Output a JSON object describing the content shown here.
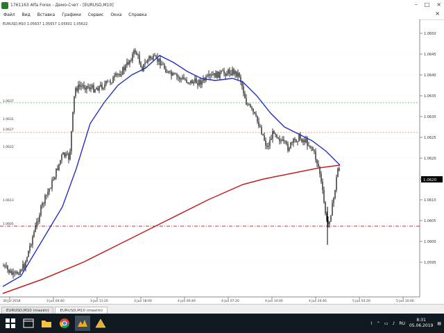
{
  "window": {
    "title": "1761163 Alfa Forex - Демо-Счет - [EURUSD,M10]",
    "minimize": "–",
    "maximize": "□",
    "close": "×"
  },
  "menu": {
    "items": [
      "Файл",
      "Вид",
      "Вставка",
      "Графики",
      "Сервис",
      "Окна",
      "Справка"
    ]
  },
  "chart": {
    "symbol_info": "EURUSD,M10  1.05637  1.05657  1.05601  1.05622",
    "price_labels": [
      "1.0650",
      "1.0645",
      "1.0640",
      "1.0635",
      "1.0630",
      "1.0625",
      "1.0620",
      "1.0615",
      "1.0610",
      "1.0605",
      "1.0600",
      "1.0595"
    ],
    "current_price": "1.0620",
    "time_labels": [
      "30 Jul 2018",
      "3 Jun 04:40",
      "3 Jun 11:20",
      "3 Jun 18:00",
      "4 Jun 00:40",
      "4 Jun 07:20",
      "4 Jun 14:00",
      "4 Jun 20:40",
      "5 Jun 03:20",
      "5 Jun 10:00"
    ],
    "level_labels": [
      "1.0637",
      "1.0631",
      "1.0627",
      "1.0622",
      "1.0613",
      "1.0605"
    ],
    "colors": {
      "candles": "#000000",
      "ma_fast": "#2030c0",
      "ma_slow": "#c02020",
      "level_green": "#7ac97a",
      "level_orange": "#f0a860",
      "level_red": "#c03030",
      "grid": "#d8d8d8"
    }
  },
  "tabs": [
    "EURUSD,M10 (maxim)",
    "EURUSD,M10 (maxim)"
  ],
  "taskbar": {
    "icons": [
      "windows-start-icon",
      "file-explorer-icon",
      "folder-icon",
      "chrome-icon",
      "metatrader-icon",
      "trading-app-icon"
    ],
    "tray_lang": "RU",
    "time": "8:31",
    "date": "05.06.2019"
  }
}
